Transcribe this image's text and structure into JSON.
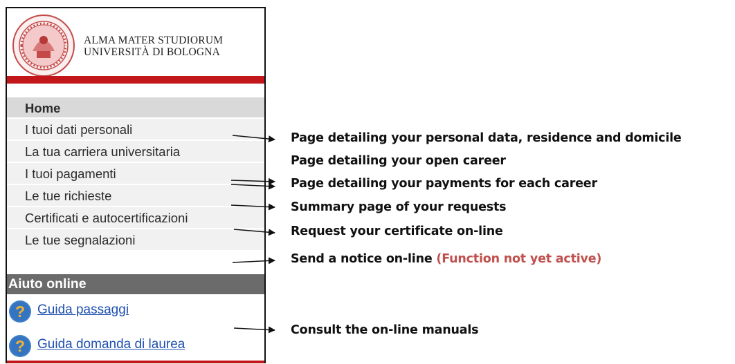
{
  "logo": {
    "line1": "ALMA MATER STUDIORUM",
    "line2": "UNIVERSITÀ DI BOLOGNA"
  },
  "nav": {
    "items": [
      {
        "label": "Home"
      },
      {
        "label": "I tuoi dati personali"
      },
      {
        "label": "La tua carriera universitaria"
      },
      {
        "label": "I tuoi pagamenti"
      },
      {
        "label": "Le tue richieste"
      },
      {
        "label": "Certificati e autocertificazioni"
      },
      {
        "label": "Le tue segnalazioni"
      }
    ]
  },
  "help": {
    "heading": "Aiuto online",
    "links": [
      {
        "label": "Guida passaggi",
        "icon": "help-circle-icon"
      },
      {
        "label": "Guida domanda di laurea",
        "icon": "help-circle-icon"
      }
    ]
  },
  "annotations": {
    "personal_data": "Page detailing your personal data, residence and domicile",
    "career": "Page detailing your open career",
    "payments": "Page detailing your payments for each career",
    "requests": "Summary page of your requests",
    "certificates": "Request your certificate on-line",
    "notice": "Send a notice on-line",
    "notice_warning": "(Function not yet active)",
    "manuals": "Consult the on-line manuals"
  },
  "colors": {
    "brand_red": "#c2171a",
    "heading_grey": "#6b6b6b",
    "link_blue": "#1d4fb0",
    "warning": "#c0504d",
    "help_icon": "#3f7fc8"
  }
}
